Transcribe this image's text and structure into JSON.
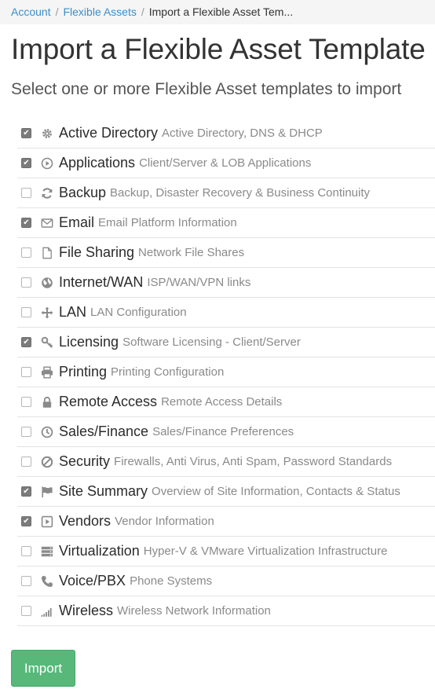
{
  "breadcrumb": {
    "items": [
      "Account",
      "Flexible Assets"
    ],
    "current": "Import a Flexible Asset Tem..."
  },
  "header": {
    "title": "Import a Flexible Asset Template",
    "subtitle": "Select one or more Flexible Asset templates to import"
  },
  "templates": [
    {
      "name": "Active Directory",
      "description": "Active Directory, DNS & DHCP",
      "checked": true,
      "icon": "gear-icon"
    },
    {
      "name": "Applications",
      "description": "Client/Server & LOB Applications",
      "checked": true,
      "icon": "play-circle-icon"
    },
    {
      "name": "Backup",
      "description": "Backup, Disaster Recovery & Business Continuity",
      "checked": false,
      "icon": "refresh-icon"
    },
    {
      "name": "Email",
      "description": "Email Platform Information",
      "checked": true,
      "icon": "envelope-icon"
    },
    {
      "name": "File Sharing",
      "description": "Network File Shares",
      "checked": false,
      "icon": "file-icon"
    },
    {
      "name": "Internet/WAN",
      "description": "ISP/WAN/VPN links",
      "checked": false,
      "icon": "globe-icon"
    },
    {
      "name": "LAN",
      "description": "LAN Configuration",
      "checked": false,
      "icon": "arrows-move-icon"
    },
    {
      "name": "Licensing",
      "description": "Software Licensing - Client/Server",
      "checked": true,
      "icon": "key-icon"
    },
    {
      "name": "Printing",
      "description": "Printing Configuration",
      "checked": false,
      "icon": "printer-icon"
    },
    {
      "name": "Remote Access",
      "description": "Remote Access Details",
      "checked": false,
      "icon": "lock-icon"
    },
    {
      "name": "Sales/Finance",
      "description": "Sales/Finance Preferences",
      "checked": false,
      "icon": "clock-icon"
    },
    {
      "name": "Security",
      "description": "Firewalls, Anti Virus, Anti Spam, Password Standards",
      "checked": false,
      "icon": "ban-icon"
    },
    {
      "name": "Site Summary",
      "description": "Overview of Site Information, Contacts & Status",
      "checked": true,
      "icon": "flag-icon"
    },
    {
      "name": "Vendors",
      "description": "Vendor Information",
      "checked": true,
      "icon": "play-square-icon"
    },
    {
      "name": "Virtualization",
      "description": "Hyper-V & VMware Virtualization Infrastructure",
      "checked": false,
      "icon": "server-icon"
    },
    {
      "name": "Voice/PBX",
      "description": "Phone Systems",
      "checked": false,
      "icon": "phone-icon"
    },
    {
      "name": "Wireless",
      "description": "Wireless Network Information",
      "checked": false,
      "icon": "signal-bars-icon"
    }
  ],
  "actions": {
    "import_label": "Import"
  },
  "colors": {
    "link": "#3a8fc9",
    "import_button": "#57b87a",
    "checkbox_checked": "#7b7b7b"
  }
}
